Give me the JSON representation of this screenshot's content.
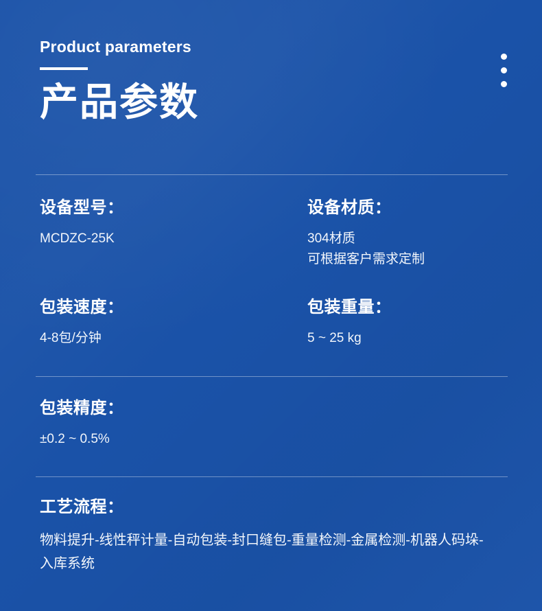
{
  "theme": {
    "background_color": "#1a52a8",
    "text_color": "#ffffff",
    "divider_color": "rgba(255,255,255,0.38)"
  },
  "header": {
    "eyebrow": "Product parameters",
    "title_cn": "产品参数"
  },
  "decoration": {
    "dots_icon": "three-dots-vertical",
    "dot_count": 3
  },
  "specs": [
    {
      "label": "设备型号：",
      "values": [
        "MCDZC-25K"
      ]
    },
    {
      "label": "设备材质：",
      "values": [
        "304材质",
        "可根据客户需求定制"
      ]
    },
    {
      "label": "包装速度：",
      "values": [
        "4-8包/分钟"
      ]
    },
    {
      "label": "包装重量：",
      "values": [
        "5 ~ 25 kg"
      ]
    },
    {
      "label": "包装精度：",
      "values": [
        "±0.2 ~ 0.5%"
      ]
    }
  ],
  "flow": {
    "label": "工艺流程：",
    "text": "物料提升-线性秤计量-自动包装-封口缝包-重量检测-金属检测-机器人码垛-入库系统",
    "steps": [
      "物料提升",
      "线性秤计量",
      "自动包装",
      "封口缝包",
      "重量检测",
      "金属检测",
      "机器人码垛",
      "入库系统"
    ]
  }
}
